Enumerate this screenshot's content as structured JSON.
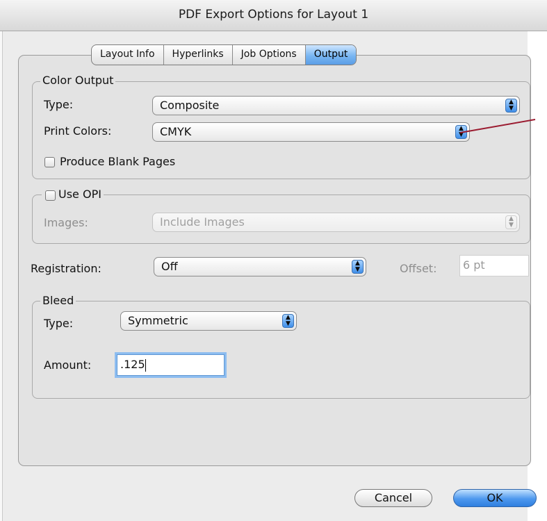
{
  "window": {
    "title": "PDF Export Options for Layout 1"
  },
  "tabs": [
    "Layout Info",
    "Hyperlinks",
    "Job Options",
    "Output"
  ],
  "active_tab": "Output",
  "color_output": {
    "legend": "Color Output",
    "type_label": "Type:",
    "type_value": "Composite",
    "print_colors_label": "Print Colors:",
    "print_colors_value": "CMYK",
    "blank_pages_label": "Produce Blank Pages",
    "blank_pages_checked": false
  },
  "opi": {
    "legend": "Use OPI",
    "checked": false,
    "images_label": "Images:",
    "images_value": "Include Images"
  },
  "registration": {
    "label": "Registration:",
    "value": "Off",
    "offset_label": "Offset:",
    "offset_value": "6 pt"
  },
  "bleed": {
    "legend": "Bleed",
    "type_label": "Type:",
    "type_value": "Symmetric",
    "amount_label": "Amount:",
    "amount_value": ".125"
  },
  "buttons": {
    "cancel": "Cancel",
    "ok": "OK"
  },
  "colors": {
    "accent_blue": "#4d98ee",
    "annotation_line": "#9b1b30"
  }
}
